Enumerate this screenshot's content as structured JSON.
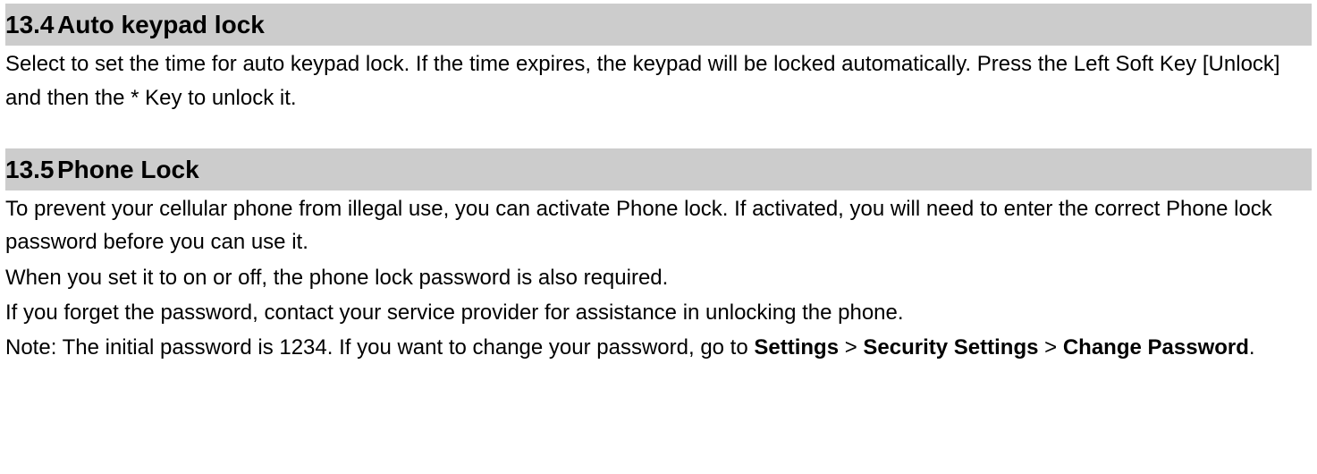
{
  "sections": [
    {
      "num": "13.4",
      "title": "Auto keypad lock",
      "body": [
        {
          "runs": [
            {
              "t": "Select to set the time for auto keypad lock. If the time expires, the keypad will be locked automatically. Press the Left Soft Key [Unlock] and then the * Key to unlock it."
            }
          ]
        }
      ]
    },
    {
      "num": "13.5",
      "title": "Phone Lock",
      "body": [
        {
          "runs": [
            {
              "t": "To prevent your cellular phone from illegal use, you can activate Phone lock. If activated, you will need to enter the correct Phone lock password before you can use it."
            }
          ]
        },
        {
          "runs": [
            {
              "t": "When you set it to on or off, the phone lock password is also required."
            }
          ]
        },
        {
          "runs": [
            {
              "t": "If you forget the password, contact your service provider for assistance in unlocking the phone."
            }
          ]
        },
        {
          "runs": [
            {
              "t": "Note: The initial password is 1234. If you want to change your password, go to "
            },
            {
              "t": "Settings",
              "b": true
            },
            {
              "t": " > "
            },
            {
              "t": "Security Settings",
              "b": true
            },
            {
              "t": " > "
            },
            {
              "t": "Change Password",
              "b": true
            },
            {
              "t": "."
            }
          ]
        }
      ]
    }
  ]
}
